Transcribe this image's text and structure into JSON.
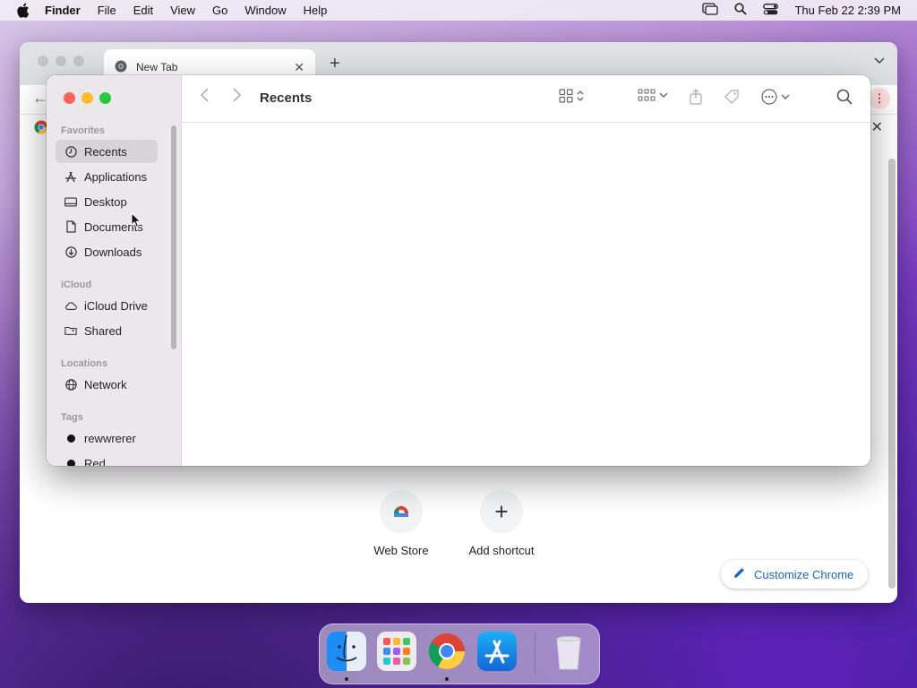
{
  "menubar": {
    "app_name": "Finder",
    "menus": [
      "File",
      "Edit",
      "View",
      "Go",
      "Window",
      "Help"
    ],
    "clock": "Thu Feb 22  2:39 PM",
    "status_icons": [
      "screen-mirroring-icon",
      "spotlight-search-icon",
      "control-center-icon"
    ]
  },
  "chrome": {
    "tab_title": "New Tab",
    "shortcuts": [
      {
        "label": "Web Store",
        "icon": "chrome-web-store-icon"
      },
      {
        "label": "Add shortcut",
        "icon": "plus-icon"
      }
    ],
    "customize_label": "Customize Chrome"
  },
  "finder": {
    "title": "Recents",
    "sections": {
      "favorites": "Favorites",
      "icloud": "iCloud",
      "locations": "Locations",
      "tags": "Tags"
    },
    "favorites": [
      {
        "label": "Recents",
        "icon": "clock-icon",
        "selected": true
      },
      {
        "label": "Applications",
        "icon": "applications-icon"
      },
      {
        "label": "Desktop",
        "icon": "desktop-icon"
      },
      {
        "label": "Documents",
        "icon": "document-icon"
      },
      {
        "label": "Downloads",
        "icon": "download-icon"
      }
    ],
    "icloud": [
      {
        "label": "iCloud Drive",
        "icon": "cloud-icon"
      },
      {
        "label": "Shared",
        "icon": "shared-folder-icon"
      }
    ],
    "locations": [
      {
        "label": "Network",
        "icon": "globe-icon"
      }
    ],
    "tags": [
      {
        "label": "rewwrerer",
        "color": "#111111"
      },
      {
        "label": "Red",
        "color": "#111111"
      }
    ]
  },
  "dock": {
    "apps": [
      "Finder",
      "Launchpad",
      "Google Chrome",
      "App Store",
      "Trash"
    ],
    "running": [
      "Finder",
      "Google Chrome"
    ]
  }
}
